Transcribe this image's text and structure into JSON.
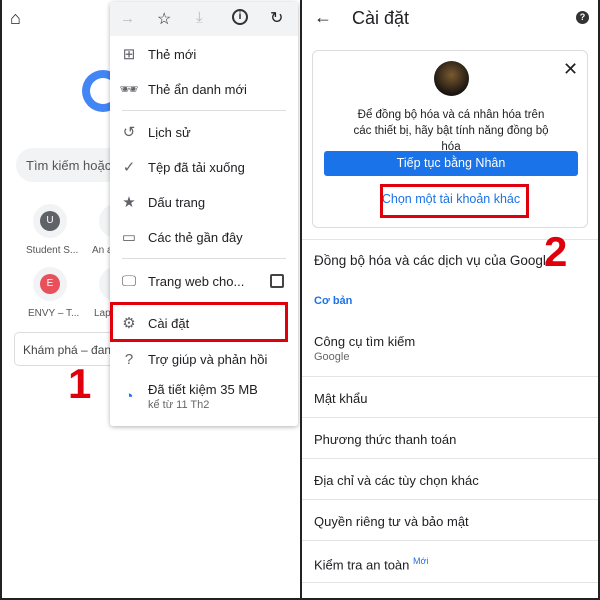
{
  "left": {
    "search_placeholder": "Tìm kiếm hoặc",
    "shortcuts": [
      {
        "letter": "U",
        "label": "Student S...",
        "color": "#5f6368"
      },
      {
        "label": "An a"
      },
      {
        "letter": "E",
        "label": "ENVY – T...",
        "color": "#e8505b"
      },
      {
        "label": "Lap"
      }
    ],
    "discover": "Khám phá – đang",
    "step": "1",
    "menu": {
      "toolbar": [
        "forward-icon",
        "star-icon",
        "download-icon",
        "info-icon",
        "reload-icon"
      ],
      "items": [
        {
          "icon": "⊞",
          "label": "Thẻ mới"
        },
        {
          "icon": "🕶",
          "label": "Thẻ ẩn danh mới"
        },
        {
          "icon": "↺",
          "label": "Lịch sử"
        },
        {
          "icon": "✓",
          "label": "Tệp đã tải xuống"
        },
        {
          "icon": "★",
          "label": "Dấu trang"
        },
        {
          "icon": "▭",
          "label": "Các thẻ gần đây"
        },
        {
          "icon": "🖵",
          "label": "Trang web cho..."
        },
        {
          "icon": "⚙",
          "label": "Cài đặt"
        },
        {
          "icon": "?",
          "label": "Trợ giúp và phản hồi"
        }
      ],
      "savings": {
        "title": "Đã tiết kiệm 35 MB",
        "sub": "kể từ 11 Th2"
      }
    }
  },
  "right": {
    "title": "Cài đặt",
    "card": {
      "text": "Để đồng bộ hóa và cá nhân hóa trên các thiết bị, hãy bật tính năng đồng bộ hóa",
      "primary": "Tiếp tục bằng Nhân",
      "secondary": "Chọn một tài khoản khác"
    },
    "step": "2",
    "sync": "Đồng bộ hóa và các dịch vụ của Google",
    "section": "Cơ bản",
    "search_engine": {
      "label": "Công cụ tìm kiếm",
      "value": "Google"
    },
    "items": [
      "Mật khẩu",
      "Phương thức thanh toán",
      "Địa chỉ và các tùy chọn khác",
      "Quyền riêng tư và bảo mật"
    ],
    "safety": "Kiểm tra an toàn",
    "new_badge": "Mới",
    "colors": {
      "accent": "#1a73e8",
      "highlight": "#e0000b"
    }
  }
}
